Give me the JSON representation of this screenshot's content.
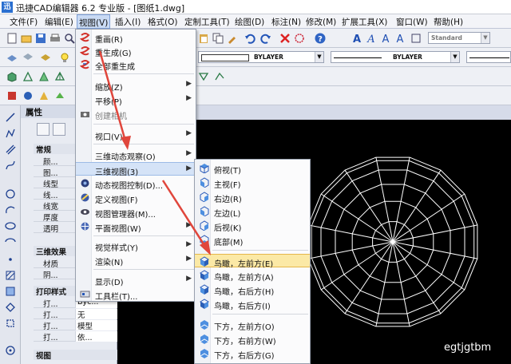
{
  "titlebar": {
    "logo": "迅",
    "title": "迅捷CAD编辑器 6.2 专业版 - [图纸1.dwg]"
  },
  "menubar": {
    "items": [
      "文件(F)",
      "编辑(E)",
      "视图(V)",
      "插入(I)",
      "格式(O)",
      "定制工具(T)",
      "绘图(D)",
      "标注(N)",
      "修改(M)",
      "扩展工具(X)",
      "窗口(W)",
      "帮助(H)"
    ],
    "active_index": 2
  },
  "toolbar": {
    "text_style_value": "Standard",
    "color_value": "BYLAYER",
    "linetype_value": "BYLAYER"
  },
  "properties_panel": {
    "title": "属性",
    "sections": [
      {
        "title": "常规",
        "rows": [
          {
            "key": "颜...",
            "value": ""
          },
          {
            "key": "图...",
            "value": ""
          },
          {
            "key": "线型",
            "value": ""
          },
          {
            "key": "线...",
            "value": ""
          },
          {
            "key": "线宽",
            "value": ""
          },
          {
            "key": "厚度",
            "value": ""
          },
          {
            "key": "透明",
            "value": ""
          }
        ]
      },
      {
        "title": "三维效果",
        "rows": [
          {
            "key": "材质",
            "value": ""
          },
          {
            "key": "阴...",
            "value": ""
          }
        ]
      },
      {
        "title": "打印样式",
        "rows": [
          {
            "key": "打...",
            "value": "Byc..."
          },
          {
            "key": "打...",
            "value": "无"
          },
          {
            "key": "打...",
            "value": "模型"
          },
          {
            "key": "打...",
            "value": "依..."
          }
        ]
      },
      {
        "title": "视图",
        "rows": []
      }
    ]
  },
  "view_menu": {
    "items": [
      {
        "label": "重画(R)",
        "icon": "redraw-icon",
        "submenu": false
      },
      {
        "label": "重生成(G)",
        "icon": "regen-icon",
        "submenu": false
      },
      {
        "label": "全部重生成",
        "icon": "regen-all-icon",
        "submenu": false
      },
      {
        "label": "缩放(Z)",
        "icon": "",
        "submenu": true
      },
      {
        "label": "平移(P)",
        "icon": "",
        "submenu": true
      },
      {
        "label": "创建相机",
        "icon": "camera-icon",
        "submenu": false
      },
      {
        "label": "视口(V)",
        "icon": "",
        "submenu": true
      },
      {
        "label": "三维动态观察(O)",
        "icon": "",
        "submenu": true
      },
      {
        "label": "三维视图(3)",
        "icon": "",
        "submenu": true
      },
      {
        "label": "动态视图控制(D)...",
        "icon": "dynamic-view-icon",
        "submenu": false
      },
      {
        "label": "定义视图(F)",
        "icon": "define-view-icon",
        "submenu": false
      },
      {
        "label": "视图管理器(M)...",
        "icon": "view-manager-icon",
        "submenu": false
      },
      {
        "label": "平面视图(W)",
        "icon": "plan-view-icon",
        "submenu": true
      },
      {
        "label": "视觉样式(Y)",
        "icon": "",
        "submenu": true
      },
      {
        "label": "渲染(N)",
        "icon": "",
        "submenu": true
      },
      {
        "label": "显示(D)",
        "icon": "",
        "submenu": true
      },
      {
        "label": "工具栏(T)...",
        "icon": "toolbar-icon",
        "submenu": false
      }
    ]
  },
  "view3d_submenu": {
    "items": [
      {
        "label": "俯视(T)",
        "icon": "top-view-icon"
      },
      {
        "label": "主视(F)",
        "icon": "front-view-icon"
      },
      {
        "label": "右边(R)",
        "icon": "right-view-icon"
      },
      {
        "label": "左边(L)",
        "icon": "left-view-icon"
      },
      {
        "label": "后视(K)",
        "icon": "back-view-icon"
      },
      {
        "label": "底部(M)",
        "icon": "bottom-view-icon"
      },
      {
        "label": "鸟瞰，左前方(E)",
        "icon": "iso-sw-icon"
      },
      {
        "label": "鸟瞰，左前方(A)",
        "icon": "iso-nw-icon"
      },
      {
        "label": "鸟瞰，右后方(H)",
        "icon": "iso-ne-icon"
      },
      {
        "label": "鸟瞰，右后方(I)",
        "icon": "iso-se-icon"
      },
      {
        "label": "下方，左前方(O)",
        "icon": "below-front-left-icon"
      },
      {
        "label": "下方，右前方(W)",
        "icon": "below-front-right-icon"
      },
      {
        "label": "下方，右后方(G)",
        "icon": "below-back-right-icon"
      }
    ],
    "highlighted_index": 6
  },
  "watermark": "egtjgtbm",
  "colors": {
    "canvas": "#000000",
    "annotation_arrow": "#e0463c",
    "highlight": "#fbe9a6"
  }
}
